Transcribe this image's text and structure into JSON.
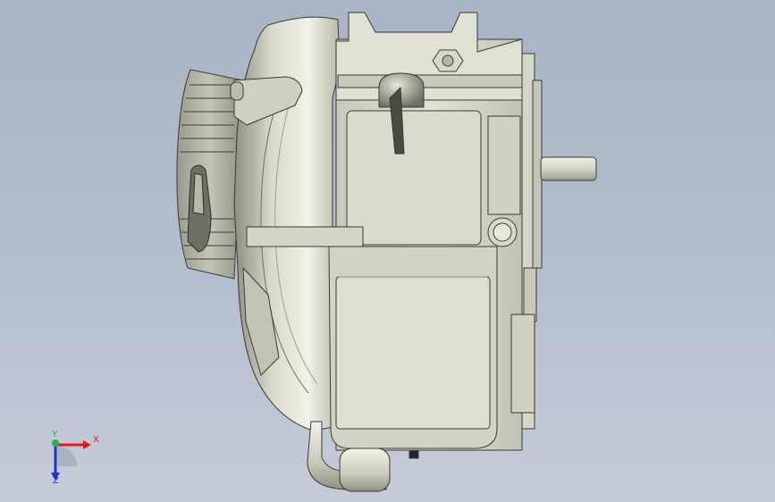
{
  "viewport": {
    "background_top": "#a9b5c6",
    "background_bottom": "#c6ccd7",
    "part_color": "#d6d6c9"
  },
  "triad": {
    "x_label": "X",
    "y_label": "Y",
    "z_label": "Z",
    "x_color": "#e01b1b",
    "y_color": "#22b14c",
    "z_color": "#2233cc"
  }
}
